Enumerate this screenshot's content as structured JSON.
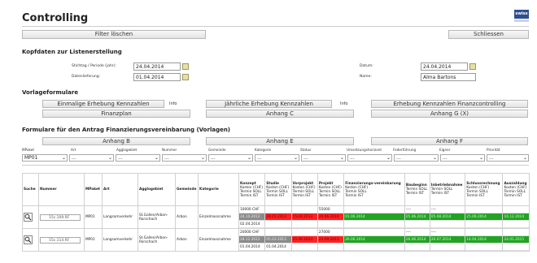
{
  "title": "Controlling",
  "logo_text": "swiss",
  "buttons": {
    "filter_clear": "Filter löschen",
    "close": "Schliessen"
  },
  "kopf": {
    "heading": "Kopfdaten zur Listenerstellung",
    "stichtag_label": "Stichtag / Periode (jahr):",
    "stichtag_value": "24.04.2014",
    "datenlieferung_label": "Datenlieferung:",
    "datenlieferung_value": "01.04.2014",
    "datum_label": "Datum:",
    "datum_value": "24.04.2014",
    "name_label": "Name:",
    "name_value": "Alma Bartons"
  },
  "vorlage": {
    "heading": "Vorlageformulare",
    "info": "Info",
    "b1": "Einmalige Erhebung Kennzahlen",
    "b2": "Jährliche Erhebung Kennzahlen",
    "b3": "Erhebung Kennzahlen Finanzcontrolling",
    "b4": "Finanzplan",
    "b5": "Anhang C",
    "b6": "Anhang G (X)"
  },
  "antrag": {
    "heading": "Formulare für den Antrag Finanzierungsvereinbarung (Vorlagen)",
    "b1": "Anhang B",
    "b2": "Anhang E",
    "b3": "Anhang F"
  },
  "filters": {
    "labels": [
      "MPaket",
      "Art",
      "Agglogebiet",
      "Nummer",
      "Gemeinde",
      "Kategorie",
      "Status",
      "Umsetzungshorizont",
      "Federführung",
      "Eigner",
      "Priorität"
    ],
    "mpaket_value": "MP01",
    "empty": "..."
  },
  "table": {
    "headers": [
      "Suche",
      "Nummer",
      "MPaket",
      "Art",
      "Agglogebiet",
      "Gemeinde",
      "Kategorie"
    ],
    "phases": [
      {
        "name": "Konzept",
        "sub": [
          "Kosten (CHF)",
          "Termin SOLL",
          "Termin IST"
        ]
      },
      {
        "name": "Studie",
        "sub": [
          "Kosten (CHF)",
          "Termin SOLL",
          "Termin IST"
        ]
      },
      {
        "name": "Vorprojekt",
        "sub": [
          "Kosten (CHF)",
          "Termin SOLL",
          "Termin IST"
        ]
      },
      {
        "name": "Projekt",
        "sub": [
          "Kosten (CHF)",
          "Termin SOLL",
          "Termin IST"
        ]
      },
      {
        "name": "Finanzierungs-vereinbarung",
        "sub": [
          "Kosten (CHF)",
          "Termin SOLL",
          "Termin IST"
        ]
      },
      {
        "name": "Baubeginn",
        "sub": [
          "Termin SOLL",
          "Termin IST"
        ]
      },
      {
        "name": "Inbetriebnahme",
        "sub": [
          "Termin SOLL",
          "Termin IST"
        ]
      },
      {
        "name": "Schlussrechnung",
        "sub": [
          "Kosten (CHF)",
          "Termin SOLL",
          "Termin IST"
        ]
      },
      {
        "name": "Auszahlung",
        "sub": [
          "Kosten (CHF)",
          "Termin SOLL",
          "Termin IST"
        ]
      }
    ],
    "rows": [
      {
        "nummer": "15c.109.RF",
        "mpaket": "MP01",
        "art": "Langsamverkehr",
        "agglo": "St.Gallen/Arbon-Rorschach",
        "gemeinde": "Arbon",
        "kategorie": "Einzelmassnahme",
        "cells": [
          [
            "10000 CHF",
            "24.10.2012",
            "02.04.2014"
          ],
          [
            "",
            "28.01.2013",
            ""
          ],
          [
            "",
            "15.04.2013",
            ""
          ],
          [
            "55000",
            "20.06.2014",
            ""
          ],
          [
            "",
            "01.06.2014",
            ""
          ],
          [
            "----",
            "05.06.2014",
            ""
          ],
          [
            "----",
            "05.08.2014",
            ""
          ],
          [
            "",
            "25.09.2014",
            ""
          ],
          [
            "",
            "16.12.2014",
            ""
          ]
        ],
        "colors": [
          [
            "",
            "gray",
            ""
          ],
          [
            "",
            "red",
            ""
          ],
          [
            "",
            "red",
            ""
          ],
          [
            "",
            "red",
            ""
          ],
          [
            "",
            "green",
            ""
          ],
          [
            "",
            "green",
            ""
          ],
          [
            "",
            "green",
            ""
          ],
          [
            "",
            "green",
            ""
          ],
          [
            "",
            "green",
            ""
          ]
        ]
      },
      {
        "nummer": "15c.114.RF",
        "mpaket": "MP01",
        "art": "Langsamverkehr",
        "agglo": "St.Gallen/Arbon-Rorschach",
        "gemeinde": "Arbon",
        "kategorie": "Einzelmassnahme",
        "cells": [
          [
            "20000 CHF",
            "28.12.2012",
            "01.04.2014"
          ],
          [
            "",
            "05.03.2013",
            "01.04.2014"
          ],
          [
            "",
            "25.06.2013",
            ""
          ],
          [
            "27000",
            "23.09.2013",
            ""
          ],
          [
            "",
            "26.06.2014",
            ""
          ],
          [
            "----",
            "26.06.2014",
            ""
          ],
          [
            "----",
            "26.07.2014",
            ""
          ],
          [
            "",
            "14.04.2014",
            ""
          ],
          [
            "",
            "24.01.2015",
            ""
          ]
        ],
        "colors": [
          [
            "",
            "gray",
            ""
          ],
          [
            "",
            "gray",
            ""
          ],
          [
            "",
            "red",
            ""
          ],
          [
            "",
            "red",
            ""
          ],
          [
            "",
            "green",
            ""
          ],
          [
            "",
            "green",
            ""
          ],
          [
            "",
            "green",
            ""
          ],
          [
            "",
            "green",
            ""
          ],
          [
            "",
            "green",
            ""
          ]
        ]
      }
    ]
  }
}
